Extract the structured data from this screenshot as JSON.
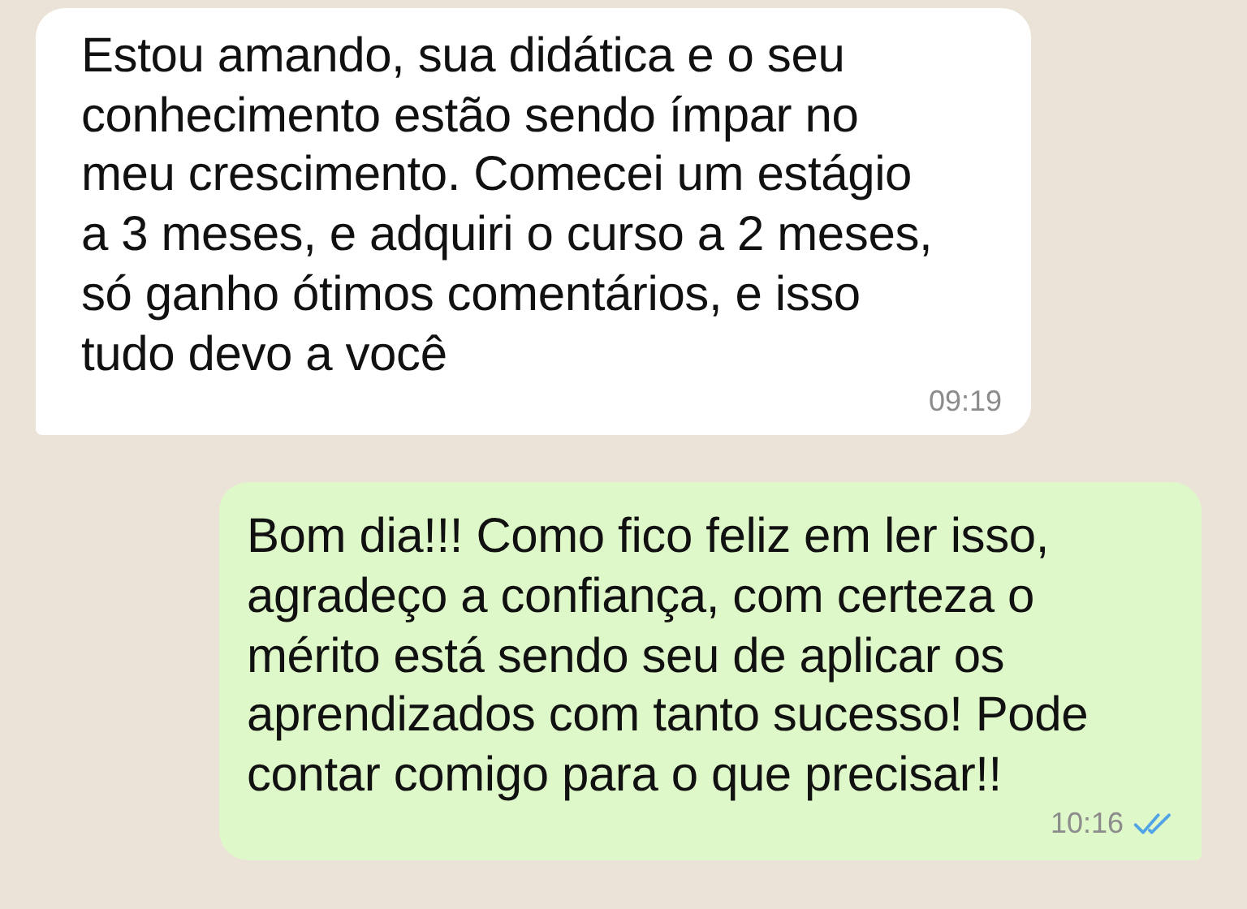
{
  "messages": [
    {
      "kind": "received",
      "text": "Estou amando, sua didática e o seu\nconhecimento estão sendo ímpar no\nmeu crescimento. Comecei um estágio\na 3 meses, e adquiri o curso a 2 meses,\nsó ganho ótimos comentários, e isso\ntudo devo a você",
      "time": "09:19"
    },
    {
      "kind": "sent",
      "text": "Bom dia!!! Como fico feliz em ler isso,\nagradeço a confiança, com certeza o\nmérito está sendo seu de aplicar os\naprendizados com tanto sucesso! Pode\ncontar comigo para o que precisar!!",
      "time": "10:16",
      "read": true
    }
  ]
}
